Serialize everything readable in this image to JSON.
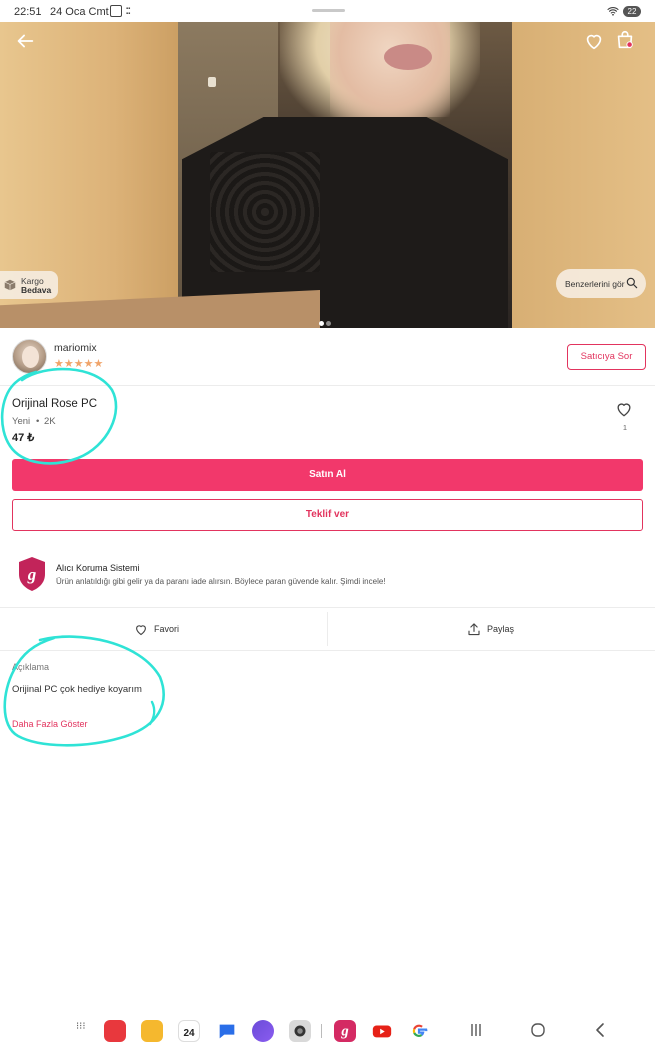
{
  "status_bar": {
    "time": "22:51",
    "date": "24 Oca Cmt",
    "battery": "22"
  },
  "hero": {
    "kargo_line1": "Kargo",
    "kargo_line2": "Bedava",
    "similar_label": "Benzerlerini gör"
  },
  "seller": {
    "name": "mariomix",
    "stars": "★★★★★",
    "ask_label": "Satıcıya Sor"
  },
  "product": {
    "title": "Orijinal Rose PC",
    "condition": "Yeni",
    "dot": "•",
    "size": "2K",
    "price": "47 ₺",
    "like_count": "1"
  },
  "buttons": {
    "buy": "Satın Al",
    "offer": "Teklif ver"
  },
  "protection": {
    "title": "Alıcı Koruma Sistemi",
    "text": "Ürün anlatıldığı gibi gelir ya da paranı iade alırsın. Böylece paran güvende kalır. Şimdi incele!"
  },
  "actions": {
    "favorite": "Favori",
    "share": "Paylaş"
  },
  "description": {
    "heading": "Açıklama",
    "text": "Orijinal PC çok hediye koyarım",
    "more": "Daha Fazla Göster"
  },
  "dock": {
    "calendar_day": "24"
  },
  "colors": {
    "accent": "#f2386b",
    "annotation": "#2fe3d6",
    "star": "#f0a46a"
  }
}
